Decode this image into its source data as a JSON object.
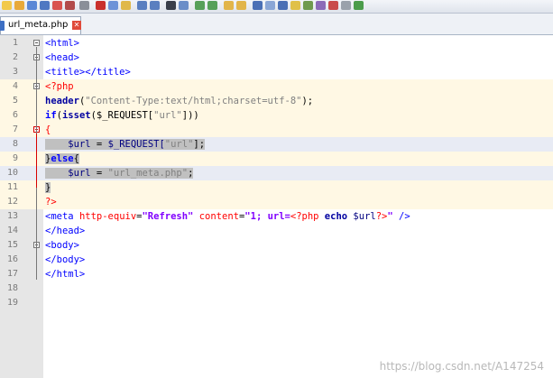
{
  "tab": {
    "filename": "url_meta.php",
    "close": "✕"
  },
  "line_numbers": [
    "1",
    "2",
    "3",
    "4",
    "5",
    "6",
    "7",
    "8",
    "9",
    "10",
    "11",
    "12",
    "13",
    "14",
    "15",
    "16",
    "17",
    "18",
    "19"
  ],
  "code": {
    "l1": "<html>",
    "l2": "<head>",
    "l3": "<title></title>",
    "l4": "<?php",
    "l5_fn": "header",
    "l5_open": "(",
    "l5_str": "\"Content-Type:text/html;charset=utf-8\"",
    "l5_close": ");",
    "l6_kw": "if",
    "l6_open": "(",
    "l6_fn": "isset",
    "l6_a": "($_REQUEST[",
    "l6_str": "\"url\"",
    "l6_b": "]))",
    "l7": "{",
    "l8_var": "$url",
    "l8_eq": " = ",
    "l8_req": "$_REQUEST[",
    "l8_str": "\"url\"",
    "l8_end": "];",
    "l9_close": "}",
    "l9_kw": "else",
    "l9_open": "{",
    "l10_var": "$url",
    "l10_eq": " = ",
    "l10_str": "\"url_meta.php\"",
    "l10_end": ";",
    "l11": "}",
    "l12": "?>",
    "l13_tag": "<meta ",
    "l13_attr1": "http-equiv",
    "l13_eq1": "=",
    "l13_val1": "\"Refresh\"",
    "l13_attr2": " content",
    "l13_eq2": "=",
    "l13_val2a": "\"1; url=",
    "l13_php1": "<?php",
    "l13_echo": " echo ",
    "l13_var": "$url",
    "l13_php2": "?>",
    "l13_val2b": "\"",
    "l13_end": " />",
    "l14": "</head>",
    "l15": "<body>",
    "l16": "</body>",
    "l17": "</html>"
  },
  "watermark": "https://blog.csdn.net/A147254",
  "colors": {
    "tag": "#0000ff",
    "php_delimiter": "#ff0000",
    "selection": "#c0c0c0",
    "current_line": "#fff8e4"
  }
}
